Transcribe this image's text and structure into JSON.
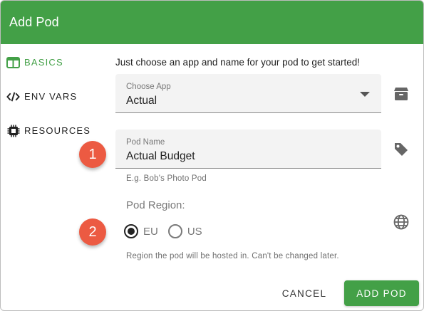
{
  "dialog": {
    "title": "Add Pod"
  },
  "nav": [
    {
      "label": "BASICS",
      "icon": "columns-icon",
      "active": true
    },
    {
      "label": "ENV VARS",
      "icon": "code-icon",
      "active": false
    },
    {
      "label": "RESOURCES",
      "icon": "chip-icon",
      "active": false
    }
  ],
  "intro_text": "Just choose an app and name for your pod to get started!",
  "app_select": {
    "label": "Choose App",
    "value": "Actual",
    "icon": "box-icon"
  },
  "pod_name": {
    "label": "Pod Name",
    "value": "Actual Budget",
    "hint": "E.g. Bob's Photo Pod",
    "icon": "tag-icon"
  },
  "region": {
    "label": "Pod Region:",
    "icon": "globe-icon",
    "options": [
      {
        "label": "EU",
        "selected": true
      },
      {
        "label": "US",
        "selected": false
      }
    ],
    "hint": "Region the pod will be hosted in. Can't be changed later."
  },
  "badges": [
    "1",
    "2"
  ],
  "actions": {
    "cancel": "CANCEL",
    "add": "ADD POD"
  },
  "colors": {
    "accent": "#43a047",
    "badge": "#ec5a42"
  }
}
